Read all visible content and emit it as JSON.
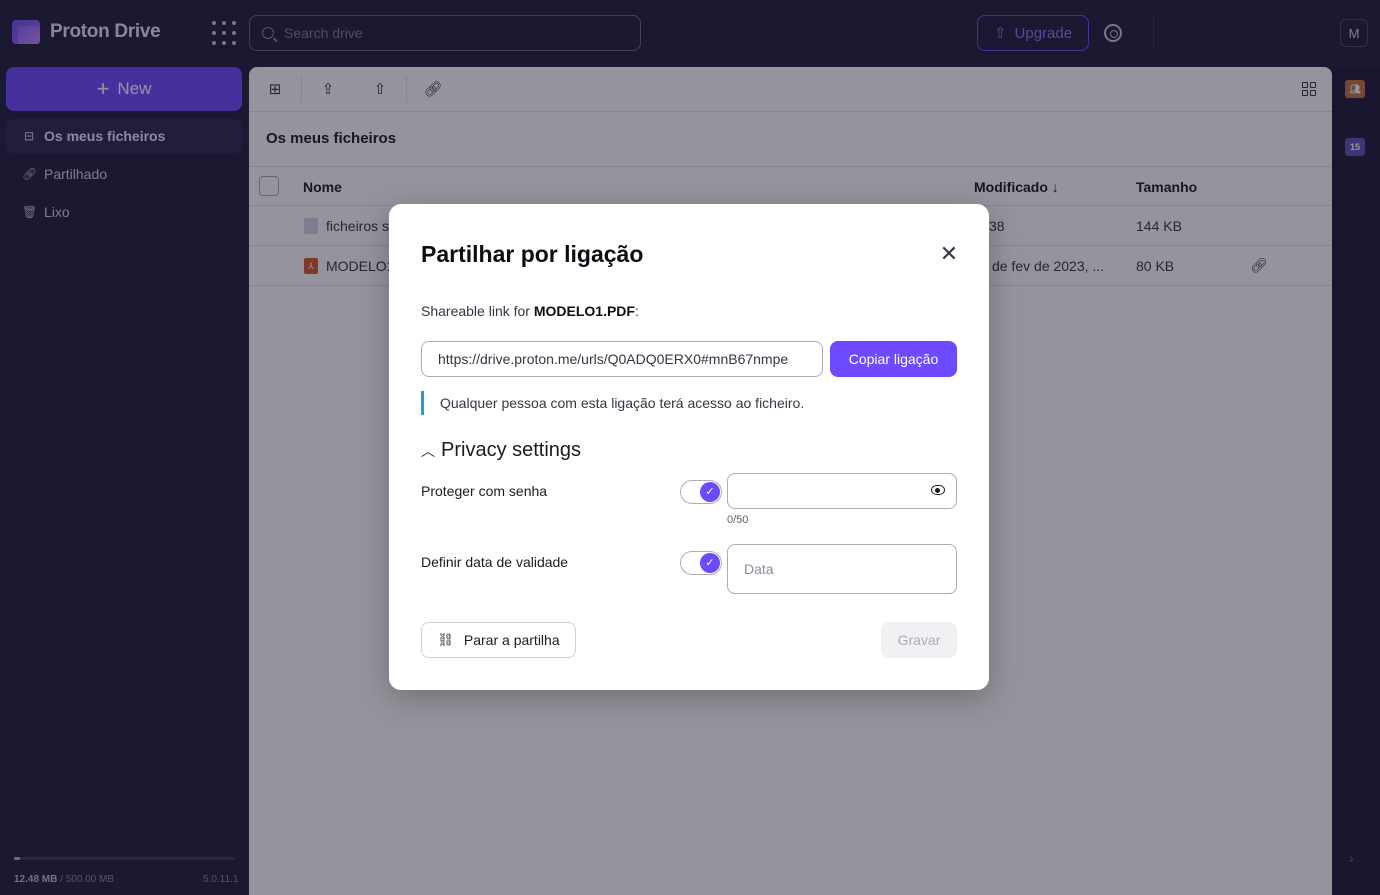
{
  "app": {
    "name": "Proton Drive",
    "avatar_letter": "M"
  },
  "search": {
    "placeholder": "Search drive"
  },
  "header": {
    "upgrade_label": "Upgrade"
  },
  "sidebar": {
    "new_label": "New",
    "items": [
      {
        "label": "Os meus ficheiros",
        "active": true
      },
      {
        "label": "Partilhado",
        "active": false
      },
      {
        "label": "Lixo",
        "active": false
      }
    ],
    "storage_used": "12.48 MB",
    "storage_total": "/ 500.00 MB",
    "storage_fraction": 0.025,
    "version": "5.0.11.1"
  },
  "rail": {
    "calendar_day": "15"
  },
  "main": {
    "breadcrumb": "Os meus ficheiros",
    "columns": {
      "name": "Nome",
      "modified": "Modificado ↓",
      "size": "Tamanho"
    },
    "rows": [
      {
        "name": "ficheiros s",
        "modified": "38",
        "size": "144 KB"
      },
      {
        "name": "MODELO1",
        "modified": "de fev de 2023, ...",
        "size": "80 KB"
      }
    ]
  },
  "modal": {
    "title": "Partilhar por ligação",
    "share_prefix": "Shareable link for ",
    "file_name": "MODELO1.PDF",
    "share_suffix": ":",
    "link_value": "https://drive.proton.me/urls/Q0ADQ0ERX0#mnB67nmpe",
    "copy_label": "Copiar ligação",
    "notice": "Qualquer pessoa com esta ligação terá acesso ao ficheiro.",
    "privacy_heading": "Privacy settings",
    "password_label": "Proteger com senha",
    "password_counter": "0/50",
    "expiry_label": "Definir data de validade",
    "date_placeholder": "Data",
    "stop_label": "Parar a partilha",
    "save_label": "Gravar"
  },
  "colors": {
    "accent": "#6d4aff",
    "sidebar_bg": "#221e3d",
    "notice_border": "#239ece"
  }
}
